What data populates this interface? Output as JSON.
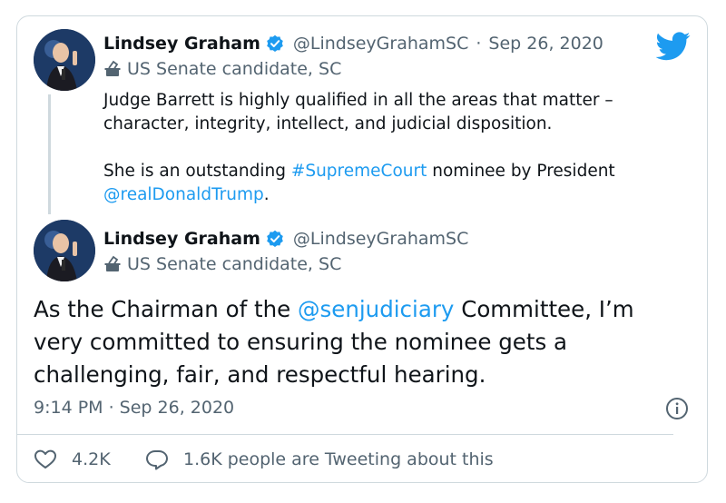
{
  "tweet_parent": {
    "author_name": "Lindsey Graham",
    "author_handle": "@LindseyGrahamSC",
    "separator": "·",
    "date": "Sep 26, 2020",
    "badge_label": "US Senate candidate, SC",
    "line1": "Judge Barrett is highly qualified in all the areas that matter –",
    "line2": "character, integrity, intellect, and judicial disposition.",
    "line3_prefix": "She is an outstanding ",
    "line3_hashtag": "#SupremeCourt",
    "line3_suffix": " nominee by President",
    "line4_mention": "@realDonaldTrump",
    "line4_suffix": "."
  },
  "tweet_main": {
    "author_name": "Lindsey Graham",
    "author_handle": "@LindseyGrahamSC",
    "badge_label": "US Senate candidate, SC",
    "line1_prefix": "As the Chairman of the ",
    "line1_mention": "@senjudiciary",
    "line1_suffix": " Committee, I’m",
    "line2": "very committed to ensuring the nominee gets a",
    "line3": "challenging, fair, and respectful hearing.",
    "timestamp": "9:14 PM · Sep 26, 2020"
  },
  "stats": {
    "likes": "4.2K",
    "conversation": "1.6K people are Tweeting about this"
  },
  "colors": {
    "link": "#1d9bf0",
    "verified": "#1d9bf0",
    "twitter_logo": "#1d9bf0",
    "muted_text": "#536471",
    "border": "#cfd9de"
  },
  "icons": [
    "verified-badge-icon",
    "twitter-bird-icon",
    "ballot-box-icon",
    "info-icon",
    "heart-icon",
    "speech-bubble-icon"
  ]
}
